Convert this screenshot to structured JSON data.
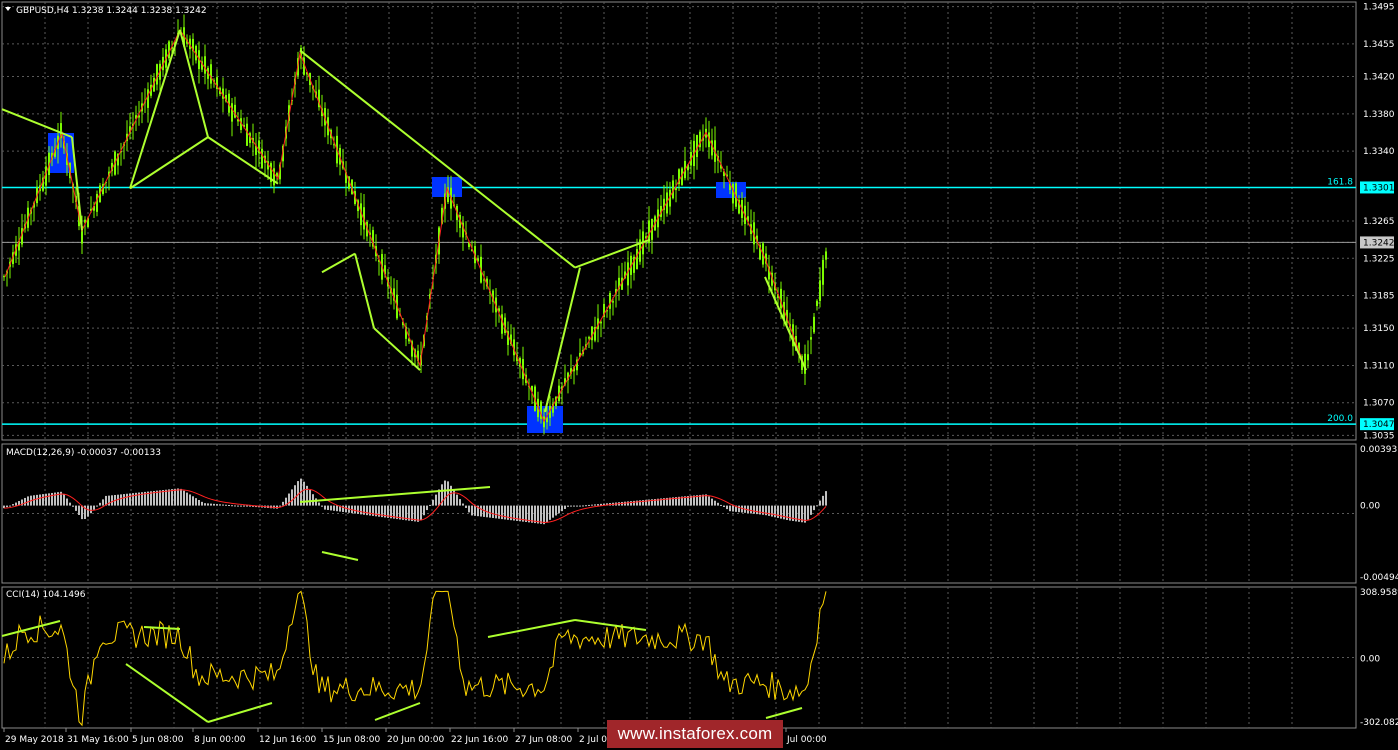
{
  "symbol_header": "GBPUSD,H4  1.3238 1.3244 1.3238 1.3242",
  "colors": {
    "background": "#000000",
    "candles": "#7CFC00",
    "grid": "#5a5a5a",
    "level_lines": "#00FFFF",
    "trend_lines": "#ADFF2F",
    "zigzag": "#FF2020",
    "signal_boxes": "#0033FF",
    "macd_histogram": "#C0C0C0",
    "macd_signal": "#FF2020",
    "cci_line": "#FFD700"
  },
  "chart_data": [
    {
      "type": "candlestick",
      "name": "GBPUSD,H4",
      "ohlc_header": "1.3238 1.3244 1.3238 1.3242",
      "y_ticks": [
        "1.3495",
        "1.3455",
        "1.3420",
        "1.3380",
        "1.3340",
        "1.3301",
        "1.3265",
        "1.3242",
        "1.3225",
        "1.3185",
        "1.3150",
        "1.3110",
        "1.3070",
        "1.3047",
        "1.3035"
      ],
      "ylim": [
        1.303,
        1.35
      ],
      "x_ticks": [
        "29 May 2018",
        "31 May 16:00",
        "5 Jun 08:00",
        "8 Jun 00:00",
        "12 Jun 16:00",
        "15 Jun 08:00",
        "20 Jun 00:00",
        "22 Jun 16:00",
        "27 Jun 08:00",
        "2 Jul 00:00",
        "Jul 00:00"
      ],
      "current_price": 1.3242,
      "levels": [
        {
          "label": "161.8",
          "value": 1.3301
        },
        {
          "label": "200.0",
          "value": 1.3047
        }
      ],
      "zigzag_points": [
        1.3205,
        1.336,
        1.3255,
        1.347,
        1.331,
        1.3445,
        1.311,
        1.33,
        1.305,
        1.336,
        1.3225,
        1.3105
      ],
      "trend_lines": [
        {
          "from": 1.3385,
          "to": 1.3355
        },
        {
          "from": 1.33,
          "to": 1.347
        },
        {
          "from": 1.33,
          "to": 1.3355
        },
        {
          "from": 1.3355,
          "to": 1.3305
        },
        {
          "from": 1.3448,
          "to": 1.3215
        },
        {
          "from": 1.3215,
          "to": 1.3245
        },
        {
          "from": 1.321,
          "to": 1.323
        },
        {
          "from": 1.315,
          "to": 1.3105
        },
        {
          "from": 1.306,
          "to": 1.3215
        },
        {
          "from": 1.3205,
          "to": 1.3105
        }
      ]
    },
    {
      "type": "histogram+line",
      "name": "MACD(12,26,9)",
      "header": "MACD(12,26,9) -0.00037 -0.00133",
      "y_ticks": [
        "0.00393",
        "0.00",
        "-0.00494"
      ],
      "ylim": [
        -0.00494,
        0.00393
      ],
      "macd_latest": -0.00037,
      "signal_latest": -0.00133
    },
    {
      "type": "line",
      "name": "CCI(14)",
      "header": "CCI(14) 104.1496",
      "y_ticks": [
        "308.9589",
        "0.00",
        "-302.082"
      ],
      "ylim": [
        -302.082,
        308.9589
      ],
      "latest": 104.1496
    }
  ],
  "watermark": "www.instaforex.com"
}
